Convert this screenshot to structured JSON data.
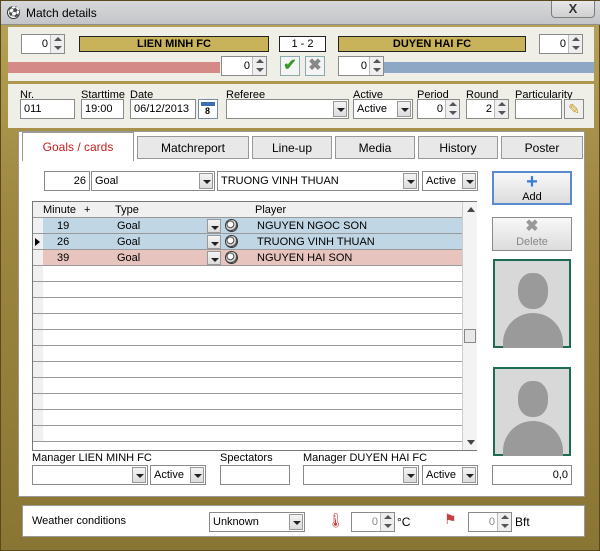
{
  "window": {
    "title": "Match details",
    "close_label": "X"
  },
  "teams": {
    "home": "LIEN MINH FC",
    "away": "DUYEN HAI FC",
    "score": "1  - 2",
    "home_value": "0",
    "away_value": "0",
    "home_sub": "0",
    "away_sub": "0"
  },
  "info": {
    "nr_label": "Nr.",
    "nr": "011",
    "starttime_label": "Starttime",
    "starttime": "19:00",
    "date_label": "Date",
    "date": "06/12/2013",
    "calendar_day": "8",
    "referee_label": "Referee",
    "referee": "",
    "active_label": "Active",
    "active": "Active",
    "period_label": "Period",
    "period": "0",
    "round_label": "Round",
    "round": "2",
    "particularity_label": "Particularity",
    "particularity": ""
  },
  "tabs": [
    "Goals / cards",
    "Matchreport",
    "Line-up",
    "Media",
    "History",
    "Poster"
  ],
  "goal_entry": {
    "minute": "26",
    "type": "Goal",
    "player": "TRUONG VINH THUAN",
    "status": "Active"
  },
  "grid": {
    "headers": {
      "minute": "Minute",
      "plus": "+",
      "type": "Type",
      "player": "Player"
    },
    "rows": [
      {
        "minute": "19",
        "type": "Goal",
        "player": "NGUYEN NGOC SON",
        "color": "#c0d6e4"
      },
      {
        "minute": "26",
        "type": "Goal",
        "player": "TRUONG VINH THUAN",
        "color": "#c0d6e4"
      },
      {
        "minute": "39",
        "type": "Goal",
        "player": "NGUYEN HAI SON",
        "color": "#e8c4bf"
      }
    ]
  },
  "buttons": {
    "add": "Add",
    "delete": "Delete"
  },
  "managers": {
    "home_label": "Manager LIEN MINH FC",
    "home_status": "Active",
    "spectators_label": "Spectators",
    "spectators": "",
    "away_label": "Manager DUYEN HAI FC",
    "away_status": "Active",
    "value": "0,0"
  },
  "weather": {
    "label": "Weather conditions",
    "value": "Unknown",
    "temp": "0",
    "temp_unit": "°C",
    "wind": "0",
    "wind_unit": "Bft"
  }
}
